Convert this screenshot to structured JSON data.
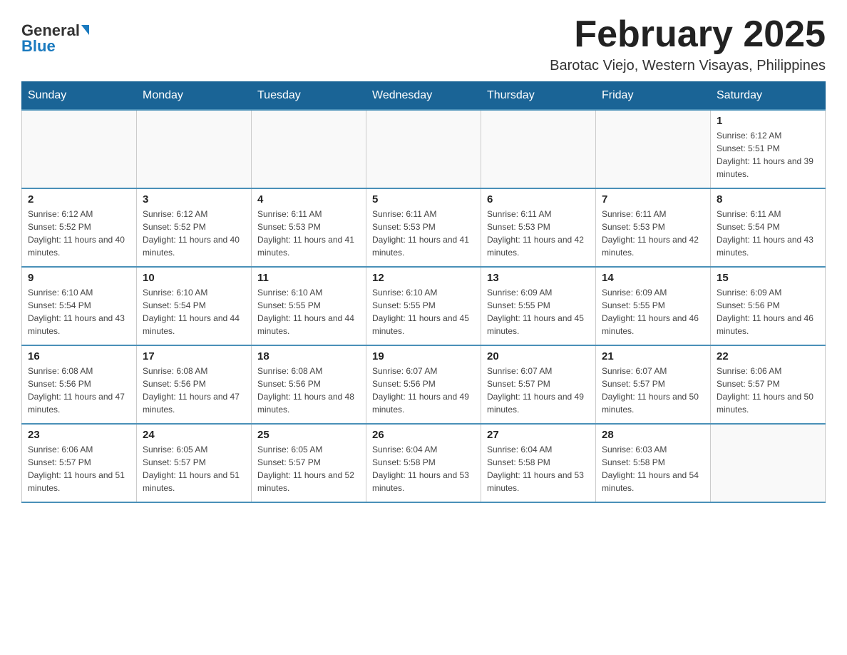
{
  "header": {
    "logo_general": "General",
    "logo_blue": "Blue",
    "month_title": "February 2025",
    "subtitle": "Barotac Viejo, Western Visayas, Philippines"
  },
  "days_of_week": [
    "Sunday",
    "Monday",
    "Tuesday",
    "Wednesday",
    "Thursday",
    "Friday",
    "Saturday"
  ],
  "weeks": [
    {
      "days": [
        {
          "date": "",
          "info": ""
        },
        {
          "date": "",
          "info": ""
        },
        {
          "date": "",
          "info": ""
        },
        {
          "date": "",
          "info": ""
        },
        {
          "date": "",
          "info": ""
        },
        {
          "date": "",
          "info": ""
        },
        {
          "date": "1",
          "info": "Sunrise: 6:12 AM\nSunset: 5:51 PM\nDaylight: 11 hours and 39 minutes."
        }
      ]
    },
    {
      "days": [
        {
          "date": "2",
          "info": "Sunrise: 6:12 AM\nSunset: 5:52 PM\nDaylight: 11 hours and 40 minutes."
        },
        {
          "date": "3",
          "info": "Sunrise: 6:12 AM\nSunset: 5:52 PM\nDaylight: 11 hours and 40 minutes."
        },
        {
          "date": "4",
          "info": "Sunrise: 6:11 AM\nSunset: 5:53 PM\nDaylight: 11 hours and 41 minutes."
        },
        {
          "date": "5",
          "info": "Sunrise: 6:11 AM\nSunset: 5:53 PM\nDaylight: 11 hours and 41 minutes."
        },
        {
          "date": "6",
          "info": "Sunrise: 6:11 AM\nSunset: 5:53 PM\nDaylight: 11 hours and 42 minutes."
        },
        {
          "date": "7",
          "info": "Sunrise: 6:11 AM\nSunset: 5:53 PM\nDaylight: 11 hours and 42 minutes."
        },
        {
          "date": "8",
          "info": "Sunrise: 6:11 AM\nSunset: 5:54 PM\nDaylight: 11 hours and 43 minutes."
        }
      ]
    },
    {
      "days": [
        {
          "date": "9",
          "info": "Sunrise: 6:10 AM\nSunset: 5:54 PM\nDaylight: 11 hours and 43 minutes."
        },
        {
          "date": "10",
          "info": "Sunrise: 6:10 AM\nSunset: 5:54 PM\nDaylight: 11 hours and 44 minutes."
        },
        {
          "date": "11",
          "info": "Sunrise: 6:10 AM\nSunset: 5:55 PM\nDaylight: 11 hours and 44 minutes."
        },
        {
          "date": "12",
          "info": "Sunrise: 6:10 AM\nSunset: 5:55 PM\nDaylight: 11 hours and 45 minutes."
        },
        {
          "date": "13",
          "info": "Sunrise: 6:09 AM\nSunset: 5:55 PM\nDaylight: 11 hours and 45 minutes."
        },
        {
          "date": "14",
          "info": "Sunrise: 6:09 AM\nSunset: 5:55 PM\nDaylight: 11 hours and 46 minutes."
        },
        {
          "date": "15",
          "info": "Sunrise: 6:09 AM\nSunset: 5:56 PM\nDaylight: 11 hours and 46 minutes."
        }
      ]
    },
    {
      "days": [
        {
          "date": "16",
          "info": "Sunrise: 6:08 AM\nSunset: 5:56 PM\nDaylight: 11 hours and 47 minutes."
        },
        {
          "date": "17",
          "info": "Sunrise: 6:08 AM\nSunset: 5:56 PM\nDaylight: 11 hours and 47 minutes."
        },
        {
          "date": "18",
          "info": "Sunrise: 6:08 AM\nSunset: 5:56 PM\nDaylight: 11 hours and 48 minutes."
        },
        {
          "date": "19",
          "info": "Sunrise: 6:07 AM\nSunset: 5:56 PM\nDaylight: 11 hours and 49 minutes."
        },
        {
          "date": "20",
          "info": "Sunrise: 6:07 AM\nSunset: 5:57 PM\nDaylight: 11 hours and 49 minutes."
        },
        {
          "date": "21",
          "info": "Sunrise: 6:07 AM\nSunset: 5:57 PM\nDaylight: 11 hours and 50 minutes."
        },
        {
          "date": "22",
          "info": "Sunrise: 6:06 AM\nSunset: 5:57 PM\nDaylight: 11 hours and 50 minutes."
        }
      ]
    },
    {
      "days": [
        {
          "date": "23",
          "info": "Sunrise: 6:06 AM\nSunset: 5:57 PM\nDaylight: 11 hours and 51 minutes."
        },
        {
          "date": "24",
          "info": "Sunrise: 6:05 AM\nSunset: 5:57 PM\nDaylight: 11 hours and 51 minutes."
        },
        {
          "date": "25",
          "info": "Sunrise: 6:05 AM\nSunset: 5:57 PM\nDaylight: 11 hours and 52 minutes."
        },
        {
          "date": "26",
          "info": "Sunrise: 6:04 AM\nSunset: 5:58 PM\nDaylight: 11 hours and 53 minutes."
        },
        {
          "date": "27",
          "info": "Sunrise: 6:04 AM\nSunset: 5:58 PM\nDaylight: 11 hours and 53 minutes."
        },
        {
          "date": "28",
          "info": "Sunrise: 6:03 AM\nSunset: 5:58 PM\nDaylight: 11 hours and 54 minutes."
        },
        {
          "date": "",
          "info": ""
        }
      ]
    }
  ]
}
